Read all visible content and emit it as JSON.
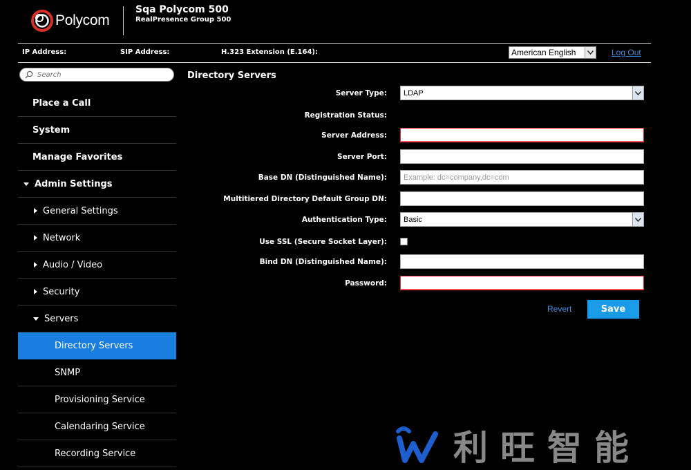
{
  "header": {
    "logo_text": "Polycom",
    "system_name": "Sqa Polycom 500",
    "system_model": "RealPresence Group 500"
  },
  "infobar": {
    "ip_label": "IP Address:",
    "sip_label": "SIP Address:",
    "h323_label": "H.323 Extension (E.164):",
    "language": "American English",
    "logout": "Log Out"
  },
  "sidebar": {
    "search_placeholder": "Search",
    "items": [
      {
        "label": "Place a Call"
      },
      {
        "label": "System"
      },
      {
        "label": "Manage Favorites"
      },
      {
        "label": "Admin Settings"
      },
      {
        "label": "General Settings"
      },
      {
        "label": "Network"
      },
      {
        "label": "Audio / Video"
      },
      {
        "label": "Security"
      },
      {
        "label": "Servers"
      },
      {
        "label": "Directory Servers"
      },
      {
        "label": "SNMP"
      },
      {
        "label": "Provisioning Service"
      },
      {
        "label": "Calendaring Service"
      },
      {
        "label": "Recording Service"
      }
    ]
  },
  "main": {
    "title": "Directory Servers",
    "fields": {
      "server_type": {
        "label": "Server Type:",
        "value": "LDAP"
      },
      "registration_status": {
        "label": "Registration Status:"
      },
      "server_address": {
        "label": "Server Address:"
      },
      "server_port": {
        "label": "Server Port:"
      },
      "base_dn": {
        "label": "Base DN (Distinguished Name):",
        "placeholder": "Example: dc=company,dc=com"
      },
      "multitiered_dn": {
        "label": "Multitiered Directory Default Group DN:"
      },
      "auth_type": {
        "label": "Authentication Type:",
        "value": "Basic"
      },
      "use_ssl": {
        "label": "Use SSL (Secure Socket Layer):"
      },
      "bind_dn": {
        "label": "Bind DN (Distinguished Name):"
      },
      "password": {
        "label": "Password:"
      }
    },
    "revert": "Revert",
    "save": "Save"
  },
  "watermark": {
    "text": "利旺智能"
  },
  "colors": {
    "accent": "#1a7ee0",
    "save_button": "#1a9be8",
    "link": "#3d8be0",
    "error_border": "#e23333"
  }
}
